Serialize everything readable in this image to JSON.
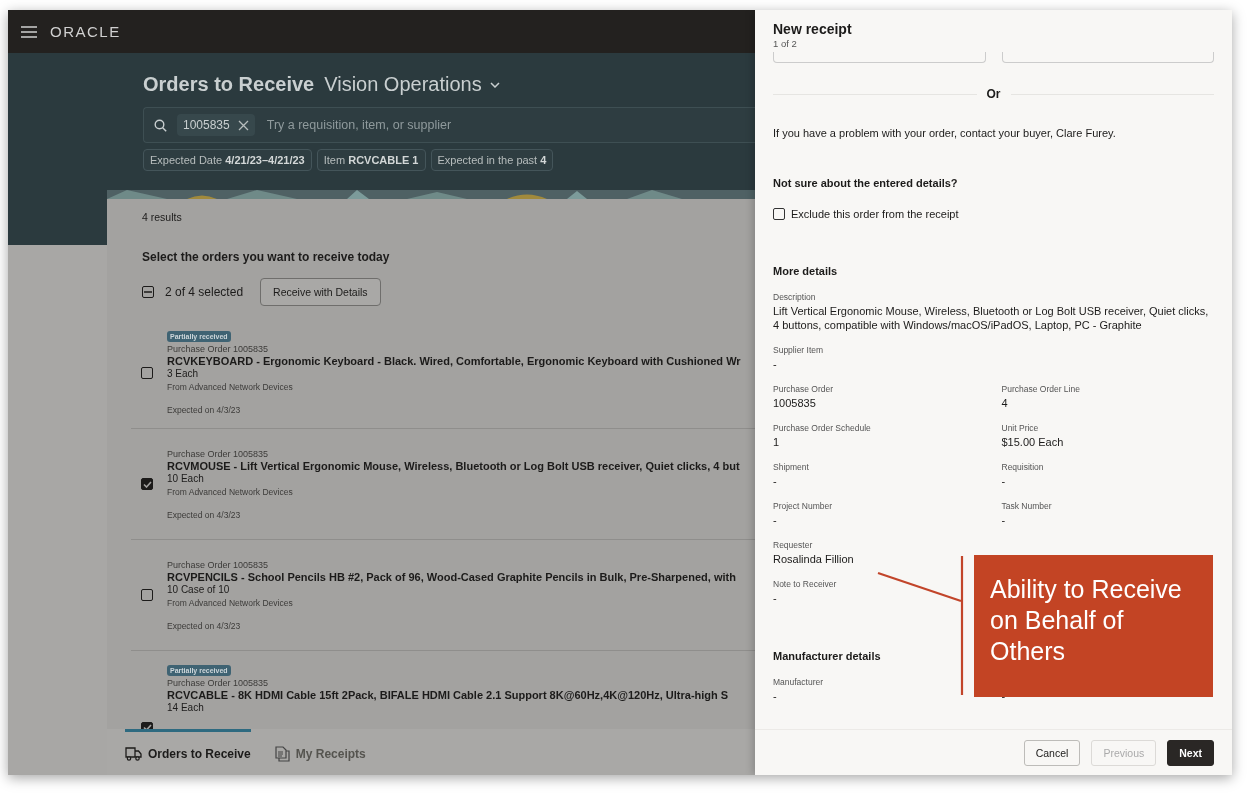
{
  "top_bar": {
    "logo": "ORACLE"
  },
  "header": {
    "title": "Orders to Receive",
    "organization": "Vision Operations"
  },
  "search": {
    "chips": [
      "1005835"
    ],
    "placeholder": "Try a requisition, item, or supplier"
  },
  "filters": [
    "Expected Date **4/21/23–4/21/23**",
    "Item **RCVCABLE  1**",
    "Expected in the past **4**"
  ],
  "results_count": "4 results",
  "list_heading": "Select the orders you want to receive today",
  "selection": {
    "label": "2 of 4 selected",
    "indeterminate": true
  },
  "receive_button": "Receive with Details",
  "orders": [
    {
      "badge": "Partially received",
      "po": "Purchase Order 1005835",
      "title": "RCVKEYBOARD - Ergonomic Keyboard - Black. Wired, Comfortable, Ergonomic Keyboard with Cushioned Wr",
      "quantity": "3 Each",
      "supplier": "From Advanced Network Devices",
      "expected": "Expected on 4/3/23",
      "checked": false
    },
    {
      "po": "Purchase Order 1005835",
      "title": "RCVMOUSE - Lift Vertical Ergonomic Mouse, Wireless, Bluetooth or Log Bolt USB receiver, Quiet clicks, 4 but",
      "quantity": "10 Each",
      "supplier": "From Advanced Network Devices",
      "expected": "Expected on 4/3/23",
      "checked": true
    },
    {
      "po": "Purchase Order 1005835",
      "title": "RCVPENCILS - School Pencils HB #2, Pack of 96, Wood-Cased Graphite Pencils in Bulk, Pre-Sharpened, with",
      "quantity": "10 Case of 10",
      "supplier": "From Advanced Network Devices",
      "expected": "Expected on 4/3/23",
      "checked": false
    },
    {
      "badge": "Partially received",
      "po": "Purchase Order 1005835",
      "title": "RCVCABLE - 8K HDMI Cable 15ft 2Pack, BIFALE HDMI Cable 2.1 Support 8K@60Hz,4K@120Hz, Ultra-high S",
      "quantity": "14 Each",
      "checked": true
    }
  ],
  "nav_tabs": [
    {
      "label": "Orders to Receive",
      "kind": "truck",
      "selected": true
    },
    {
      "label": "My Receipts",
      "kind": "document",
      "selected": false
    }
  ],
  "drawer": {
    "title": "New receipt",
    "step": "1 of 2",
    "divider_text": "Or",
    "contact_text": "If you have a problem with your order, contact your buyer, Clare Furey.",
    "check_heading": "Not sure about the entered details?",
    "exclude_checkbox": {
      "label": "Exclude this order from the receipt",
      "checked": false
    },
    "details_heading": "More details",
    "fields": [
      {
        "label": "Description",
        "value": "Lift Vertical Ergonomic Mouse, Wireless, Bluetooth or Log Bolt USB receiver, Quiet clicks, 4 buttons, compatible with Windows/macOS/iPadOS, Laptop, PC - Graphite",
        "kind": "wide"
      },
      {
        "label": "Supplier Item",
        "value": "-",
        "kind": "wide"
      },
      {
        "label": "Purchase Order",
        "value": "1005835",
        "kind": "half"
      },
      {
        "label": "Purchase Order Line",
        "value": "4",
        "kind": "half"
      },
      {
        "label": "Purchase Order Schedule",
        "value": "1",
        "kind": "half"
      },
      {
        "label": "Unit Price",
        "value": "$15.00 Each",
        "kind": "half"
      },
      {
        "label": "Shipment",
        "value": "-",
        "kind": "half"
      },
      {
        "label": "Requisition",
        "value": "-",
        "kind": "half"
      },
      {
        "label": "Project Number",
        "value": "-",
        "kind": "half"
      },
      {
        "label": "Task Number",
        "value": "-",
        "kind": "half"
      },
      {
        "label": "Requester",
        "value": "Rosalinda Fillion",
        "kind": "wide"
      },
      {
        "label": "Note to Receiver",
        "value": "-",
        "kind": "wide"
      }
    ],
    "manufacturer_heading": "Manufacturer details",
    "manufacturer_fields": [
      {
        "label": "Manufacturer",
        "value": "-"
      },
      {
        "value": "-"
      }
    ],
    "buttons": [
      {
        "label": "Cancel",
        "kind": "secondary",
        "disabled": false
      },
      {
        "label": "Previous",
        "kind": "secondary",
        "disabled": true
      },
      {
        "label": "Next",
        "kind": "primary",
        "disabled": false
      }
    ]
  },
  "callout": {
    "text": "Ability to Receive on Behalf of Others"
  }
}
